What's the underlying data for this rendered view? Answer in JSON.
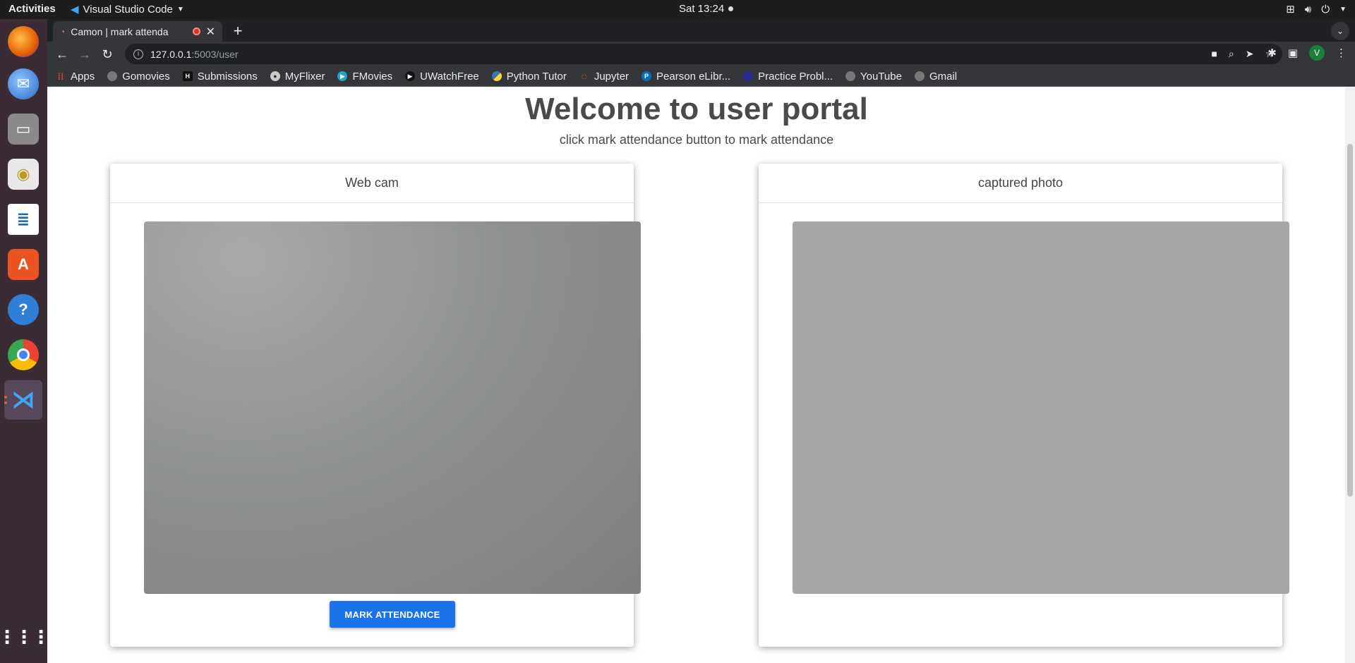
{
  "system": {
    "activities": "Activities",
    "app_name": "Visual Studio Code",
    "clock": "Sat 13:24"
  },
  "dock": {
    "items": [
      {
        "name": "firefox",
        "icon": "firefox-icon",
        "color": "#e66000"
      },
      {
        "name": "thunderbird",
        "icon": "thunderbird-icon",
        "color": "#2a6cc4"
      },
      {
        "name": "files",
        "icon": "files-icon",
        "color": "#6d6d6d"
      },
      {
        "name": "rhythmbox",
        "icon": "rhythmbox-icon",
        "color": "#e8e8e8"
      },
      {
        "name": "writer",
        "icon": "writer-icon",
        "color": "#1e68b4"
      },
      {
        "name": "software",
        "icon": "software-icon",
        "color": "#e95420"
      },
      {
        "name": "help",
        "icon": "help-icon",
        "color": "#2f7fd8"
      },
      {
        "name": "chrome",
        "icon": "chrome-icon",
        "color": "#34a853"
      },
      {
        "name": "vscode",
        "icon": "vscode-icon",
        "color": "#007acc"
      }
    ]
  },
  "browser": {
    "tab_title": "Camon | mark attenda",
    "url_host": "127.0.0.1",
    "url_path": ":5003/user",
    "profile_initial": "V",
    "bookmarks": [
      {
        "label": "Apps",
        "icon": "apps-grid-icon",
        "color": "#ea4335"
      },
      {
        "label": "Gomovies",
        "icon": "globe-icon",
        "color": "#777777"
      },
      {
        "label": "Submissions",
        "icon": "hackerrank-icon",
        "color": "#1e1e1e"
      },
      {
        "label": "MyFlixer",
        "icon": "film-icon",
        "color": "#cccccc"
      },
      {
        "label": "FMovies",
        "icon": "play-icon",
        "color": "#1aa9c4"
      },
      {
        "label": "UWatchFree",
        "icon": "play-circle-icon",
        "color": "#111111"
      },
      {
        "label": "Python Tutor",
        "icon": "python-icon",
        "color": "#3776ab"
      },
      {
        "label": "Jupyter",
        "icon": "jupyter-icon",
        "color": "#f37626"
      },
      {
        "label": "Pearson eLibr...",
        "icon": "pearson-icon",
        "color": "#0071bc"
      },
      {
        "label": "Practice Probl...",
        "icon": "leetcode-icon",
        "color": "#2b2b8f"
      },
      {
        "label": "YouTube",
        "icon": "globe-icon",
        "color": "#777777"
      },
      {
        "label": "Gmail",
        "icon": "globe-icon",
        "color": "#777777"
      }
    ]
  },
  "page": {
    "heading": "Welcome to user portal",
    "subheading": "click mark attendance button to mark attendance",
    "webcam_card": {
      "title": "Web cam",
      "button": "MARK ATTENDANCE"
    },
    "photo_card": {
      "title": "captured photo"
    }
  }
}
